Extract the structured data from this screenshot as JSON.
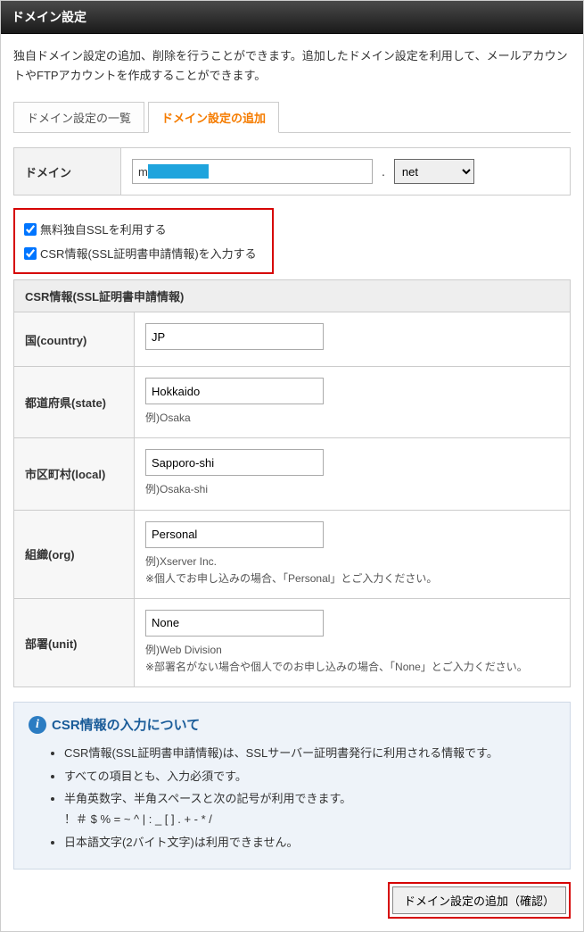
{
  "panel": {
    "title": "ドメイン設定",
    "description": "独自ドメイン設定の追加、削除を行うことができます。追加したドメイン設定を利用して、メールアカウントやFTPアカウントを作成することができます。"
  },
  "tabs": {
    "list": "ドメイン設定の一覧",
    "add": "ドメイン設定の追加"
  },
  "domainRow": {
    "label": "ドメイン",
    "input_prefix": "m",
    "dot": ".",
    "tld": "net"
  },
  "checkboxes": {
    "ssl": "無料独自SSLを利用する",
    "csr": "CSR情報(SSL証明書申請情報)を入力する"
  },
  "csr": {
    "section_title": "CSR情報(SSL証明書申請情報)",
    "country": {
      "label": "国(country)",
      "value": "JP"
    },
    "state": {
      "label": "都道府県(state)",
      "value": "Hokkaido",
      "hint": "例)Osaka"
    },
    "local": {
      "label": "市区町村(local)",
      "value": "Sapporo-shi",
      "hint": "例)Osaka-shi"
    },
    "org": {
      "label": "組織(org)",
      "value": "Personal",
      "hint": "例)Xserver Inc.\n※個人でお申し込みの場合、「Personal」とご入力ください。"
    },
    "unit": {
      "label": "部署(unit)",
      "value": "None",
      "hint": "例)Web Division\n※部署名がない場合や個人でのお申し込みの場合、「None」とご入力ください。"
    }
  },
  "info": {
    "title": "CSR情報の入力について",
    "items": [
      "CSR情報(SSL証明書申請情報)は、SSLサーバー証明書発行に利用される情報です。",
      "すべての項目とも、入力必須です。",
      "半角英数字、半角スペースと次の記号が利用できます。\n！＃ $ % = ~ ^ | : _ [ ] . + - * /",
      "日本語文字(2バイト文字)は利用できません。"
    ]
  },
  "submit": {
    "label": "ドメイン設定の追加（確認）"
  }
}
